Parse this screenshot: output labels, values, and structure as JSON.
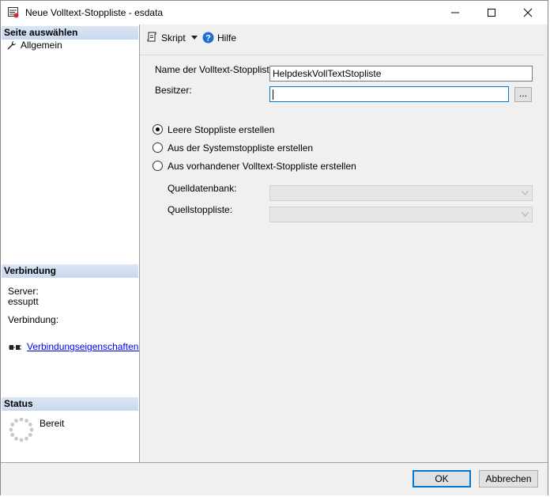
{
  "window": {
    "title": "Neue Volltext-Stoppliste - esdata"
  },
  "left_pane": {
    "select_page_header": "Seite auswählen",
    "nav_items": [
      {
        "label": "Allgemein",
        "icon": "wrench-icon"
      }
    ],
    "connection_header": "Verbindung",
    "server_label": "Server:",
    "server_value": "essuptt",
    "connection_label": "Verbindung:",
    "connection_link": "Verbindungseigenschaften anzeigen",
    "status_header": "Status",
    "status_value": "Bereit"
  },
  "toolbar": {
    "script_label": "Skript",
    "help_label": "Hilfe"
  },
  "form": {
    "name_label": "Name der Volltext-Stoppliste:",
    "name_value": "HelpdeskVollTextStopliste",
    "owner_label": "Besitzer:",
    "owner_value": "",
    "browse_label": "...",
    "radio_options": [
      {
        "label": "Leere Stoppliste erstellen",
        "checked": true
      },
      {
        "label": "Aus der Systemstoppliste erstellen",
        "checked": false
      },
      {
        "label": "Aus vorhandener Volltext-Stoppliste erstellen",
        "checked": false
      }
    ],
    "source_db_label": "Quelldatenbank:",
    "source_stoplist_label": "Quellstoppliste:"
  },
  "buttons": {
    "ok": "OK",
    "cancel": "Abbrechen"
  },
  "colors": {
    "accent": "#0078d7",
    "section_header": "#d3e0f1",
    "link": "#0000ee"
  }
}
